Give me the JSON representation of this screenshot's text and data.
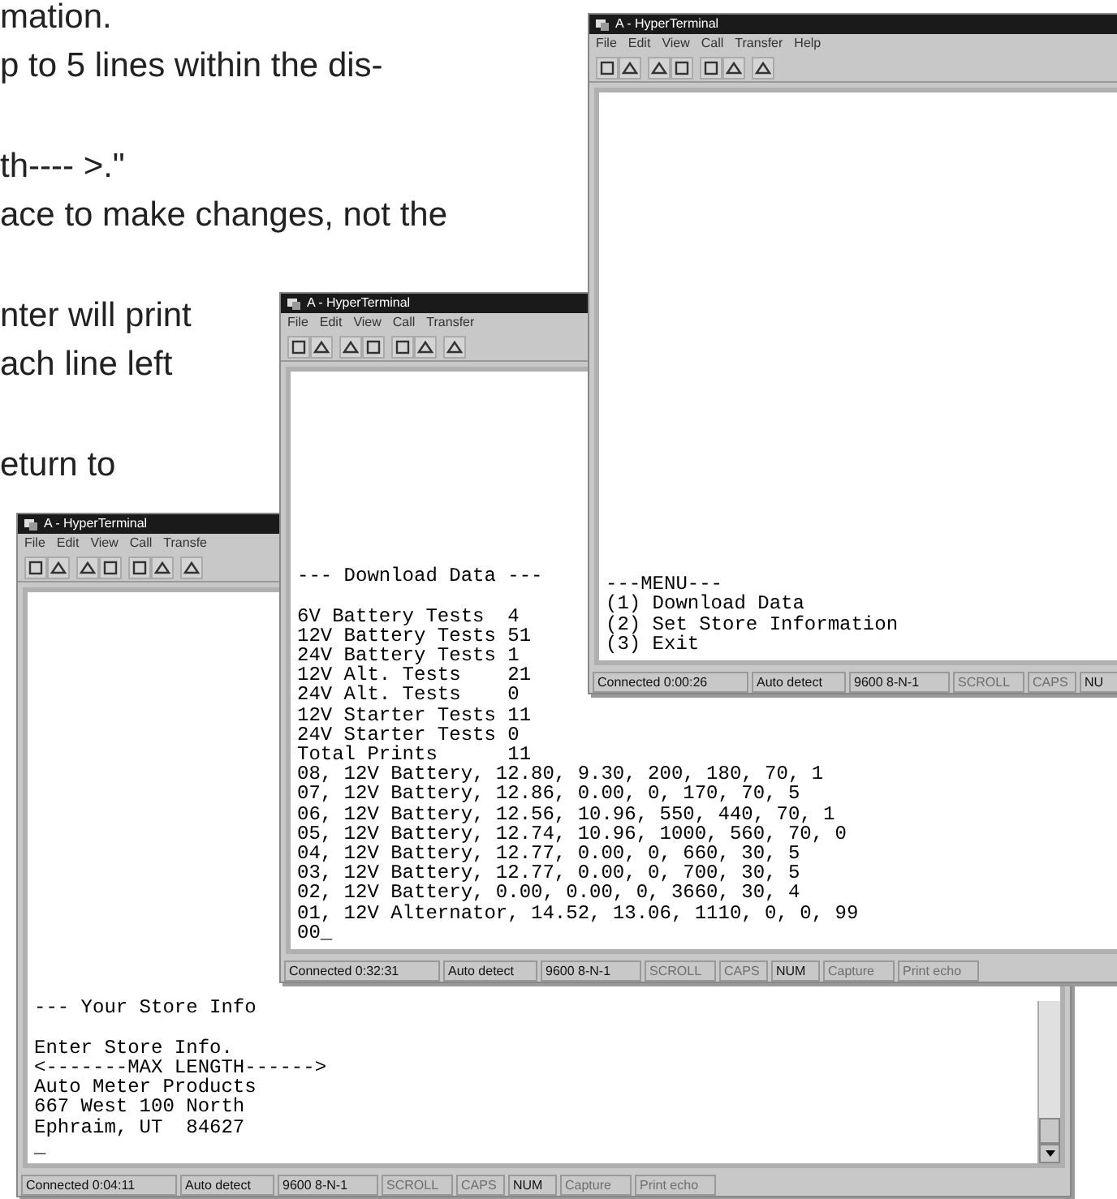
{
  "page_text": [
    [
      "mation.",
      "p to 5 lines within the dis-"
    ],
    [
      "th---- >.\"",
      "ace to make changes, not the"
    ],
    [
      "nter will print",
      "ach line left"
    ],
    [
      "eturn to"
    ]
  ],
  "windows": [
    {
      "title": "A - HyperTerminal",
      "menu": [
        "File",
        "Edit",
        "View",
        "Call",
        "Transfer",
        "Help"
      ],
      "terminal_lines": [
        "---MENU---",
        "(1) Download Data",
        "(2) Set Store Information",
        "(3) Exit"
      ],
      "status_bar": [
        {
          "text": "Connected 0:00:26",
          "disabled": false
        },
        {
          "text": "Auto detect",
          "disabled": false
        },
        {
          "text": "9600 8-N-1",
          "disabled": false
        },
        {
          "text": "SCROLL",
          "disabled": true
        },
        {
          "text": "CAPS",
          "disabled": true
        },
        {
          "text": "NU",
          "disabled": false
        }
      ]
    },
    {
      "title": "A - HyperTerminal",
      "menu": [
        "File",
        "Edit",
        "View",
        "Call",
        "Transfer"
      ],
      "heading_gap": true,
      "terminal_lines": [
        "--- Download Data ---",
        "6V Battery Tests  4",
        "12V Battery Tests 51",
        "24V Battery Tests 1",
        "12V Alt. Tests    21",
        "24V Alt. Tests    0",
        "12V Starter Tests 11",
        "24V Starter Tests 0",
        "Total Prints      11",
        "08, 12V Battery, 12.80, 9.30, 200, 180, 70, 1",
        "07, 12V Battery, 12.86, 0.00, 0, 170, 70, 5",
        "06, 12V Battery, 12.56, 10.96, 550, 440, 70, 1",
        "05, 12V Battery, 12.74, 10.96, 1000, 560, 70, 0",
        "04, 12V Battery, 12.77, 0.00, 0, 660, 30, 5",
        "03, 12V Battery, 12.77, 0.00, 0, 700, 30, 5",
        "02, 12V Battery, 0.00, 0.00, 0, 3660, 30, 4",
        "01, 12V Alternator, 14.52, 13.06, 1110, 0, 0, 99",
        "00_"
      ],
      "status_bar": [
        {
          "text": "Connected 0:32:31",
          "disabled": false
        },
        {
          "text": "Auto detect",
          "disabled": false
        },
        {
          "text": "9600 8-N-1",
          "disabled": false
        },
        {
          "text": "SCROLL",
          "disabled": true
        },
        {
          "text": "CAPS",
          "disabled": true
        },
        {
          "text": "NUM",
          "disabled": false
        },
        {
          "text": "Capture",
          "disabled": true
        },
        {
          "text": "Print echo",
          "disabled": true
        }
      ]
    },
    {
      "title": "A - HyperTerminal",
      "menu": [
        "File",
        "Edit",
        "View",
        "Call",
        "Transfe"
      ],
      "heading_gap": true,
      "terminal_lines": [
        "--- Your Store Info",
        "Enter Store Info.",
        "<-------MAX LENGTH------>",
        "Auto Meter Products",
        "667 West 100 North",
        "Ephraim, UT  84627",
        "_"
      ],
      "status_bar": [
        {
          "text": "Connected 0:04:11",
          "disabled": false
        },
        {
          "text": "Auto detect",
          "disabled": false
        },
        {
          "text": "9600 8-N-1",
          "disabled": false
        },
        {
          "text": "SCROLL",
          "disabled": true
        },
        {
          "text": "CAPS",
          "disabled": true
        },
        {
          "text": "NUM",
          "disabled": false
        },
        {
          "text": "Capture",
          "disabled": true
        },
        {
          "text": "Print echo",
          "disabled": true
        }
      ]
    }
  ]
}
